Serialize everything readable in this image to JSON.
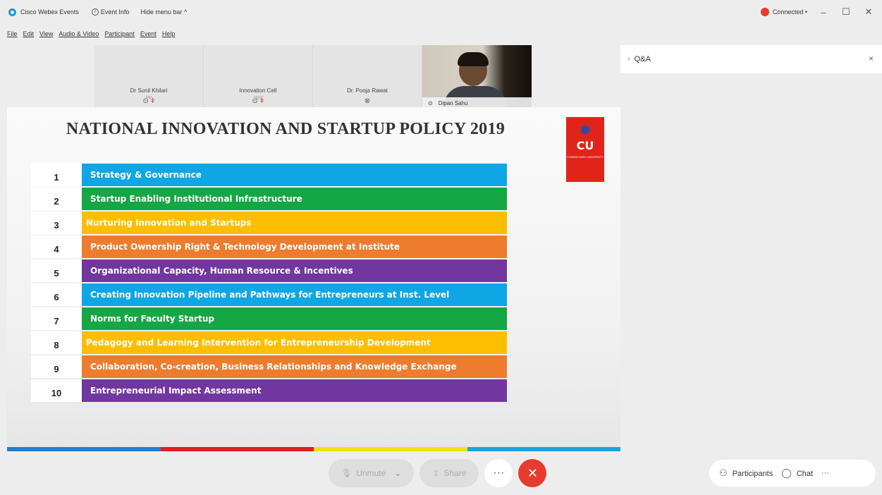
{
  "titlebar": {
    "app_name": "Cisco Webex Events",
    "event_info": "Event Info",
    "hide_menu": "Hide menu bar ^",
    "connection": "Connected •",
    "minimize": "–",
    "maximize": "☐",
    "close": "✕"
  },
  "menu": [
    "File",
    "Edit",
    "View",
    "Audio & Video",
    "Participant",
    "Event",
    "Help"
  ],
  "participants": [
    {
      "name": "Dr Sunil Khilari",
      "role": "Me"
    },
    {
      "name": "Innovation Cell",
      "role": "Host"
    },
    {
      "name": "Dr. Pooja Rawat",
      "role": ""
    }
  ],
  "video": {
    "name": "Dipan Sahu"
  },
  "slide": {
    "title": "NATIONAL INNOVATION AND STARTUP POLICY 2019",
    "logo_text": "CU",
    "logo_sub": "CHANDIGARH UNIVERSITY",
    "items": [
      {
        "num": "1",
        "label": "Strategy & Governance",
        "color": "blue"
      },
      {
        "num": "2",
        "label": "Startup Enabling Institutional Infrastructure",
        "color": "green"
      },
      {
        "num": "3",
        "label": "Nurturing Innovation and Startups",
        "color": "yellow"
      },
      {
        "num": "4",
        "label": "Product Ownership Right & Technology Development at Institute",
        "color": "orange"
      },
      {
        "num": "5",
        "label": "Organizational Capacity, Human Resource & Incentives",
        "color": "purple"
      },
      {
        "num": "6",
        "label": "Creating Innovation Pipeline and Pathways for Entrepreneurs at Inst. Level",
        "color": "blue"
      },
      {
        "num": "7",
        "label": "Norms for Faculty Startup",
        "color": "green"
      },
      {
        "num": "8",
        "label": "Pedagogy and Learning Intervention for Entrepreneurship Development",
        "color": "yellow"
      },
      {
        "num": "9",
        "label": "Collaboration, Co-creation, Business Relationships and Knowledge Exchange",
        "color": "orange"
      },
      {
        "num": "10",
        "label": "Entrepreneurial Impact Assessment",
        "color": "purple"
      }
    ],
    "strip_colors": [
      "#1e7fd0",
      "#e01f1f",
      "#f2e20a",
      "#1aa3e0"
    ]
  },
  "controls": {
    "unmute": "Unmute",
    "share": "Share",
    "more": "···",
    "leave": "✕"
  },
  "panel": {
    "title": "Q&A",
    "close": "×"
  },
  "footer": {
    "participants": "Participants",
    "chat": "Chat",
    "more": "···"
  }
}
